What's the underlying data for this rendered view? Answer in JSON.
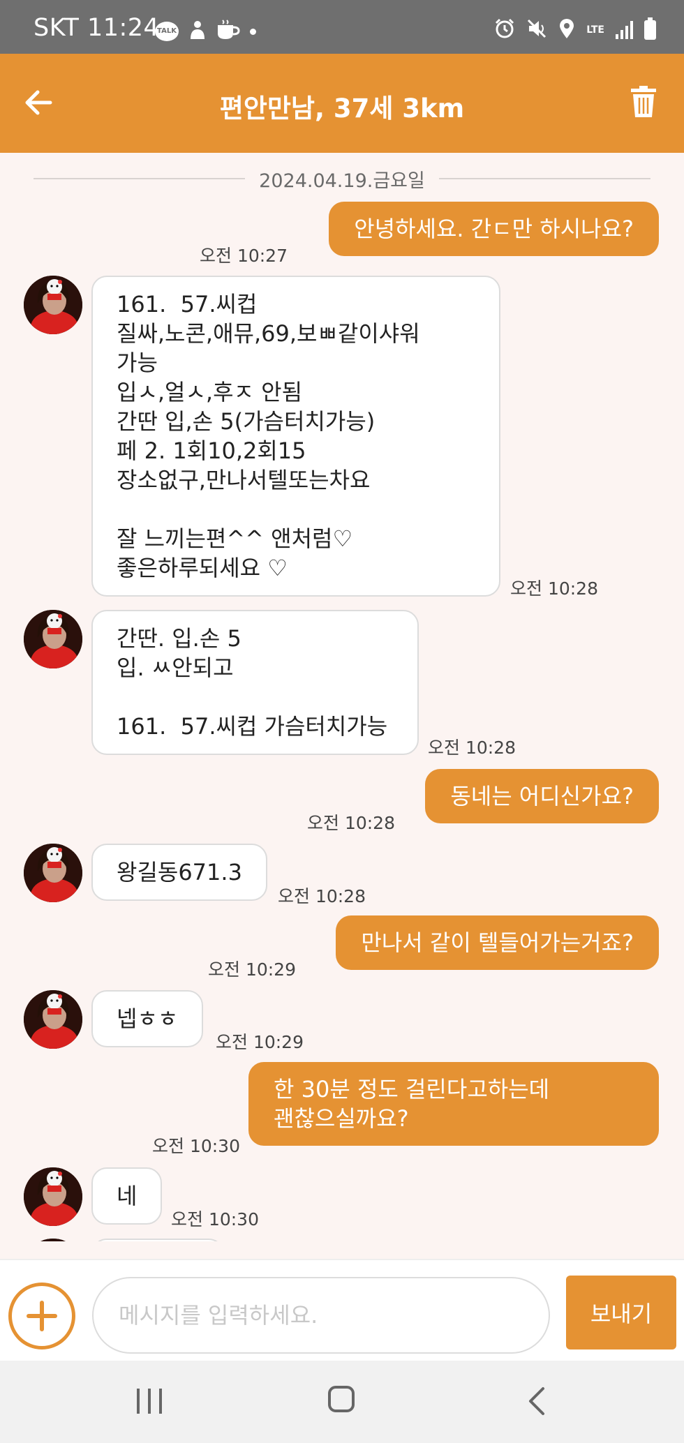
{
  "status_bar": {
    "carrier_time": "SKT 11:24",
    "talk_badge": "TALK",
    "network": "LTE",
    "icons": [
      "kakaotalk-icon",
      "person-icon",
      "coffee-icon",
      "alarm-icon",
      "mute-icon",
      "location-icon",
      "signal-icon",
      "battery-icon"
    ]
  },
  "header": {
    "title": "편안만남, 37세 3km",
    "back_icon": "arrow-left-icon",
    "delete_icon": "trash-icon",
    "color": "#e59233"
  },
  "chat": {
    "date": "2024.04.19.금요일",
    "messages": [
      {
        "dir": "sent",
        "text": "안녕하세요. 간ㄷ만 하시나요?",
        "time": "오전 10:27"
      },
      {
        "dir": "recv",
        "text": "161.  57.씨컵\n질싸,노콘,애뮤,69,보ㅃ같이샤워\n가능\n입ㅅ,얼ㅅ,후ㅈ 안됨\n간딴 입,손 5(가슴터치가능)\n페 2. 1회10,2회15\n장소없구,만나서텔또는차요\n\n잘 느끼는편^^ 앤처럼♡\n좋은하루되세요 ♡",
        "time": "오전 10:28"
      },
      {
        "dir": "recv",
        "text": "간딴. 입.손 5\n입. ㅆ안되고\n\n161.  57.씨컵 가슴터치가능",
        "time": "오전 10:28"
      },
      {
        "dir": "sent",
        "text": "동네는 어디신가요?",
        "time": "오전 10:28"
      },
      {
        "dir": "recv",
        "text": "왕길동671.3",
        "time": "오전 10:28"
      },
      {
        "dir": "sent",
        "text": "만나서 같이 텔들어가는거죠?",
        "time": "오전 10:29"
      },
      {
        "dir": "recv",
        "text": "넵ㅎㅎ",
        "time": "오전 10:29"
      },
      {
        "dir": "sent",
        "text": "한 30분 정도 걸린다고하는데\n괜찮으실까요?",
        "time": "오전 10:30"
      },
      {
        "dir": "recv",
        "text": "네",
        "time": "오전 10:30"
      }
    ]
  },
  "input_bar": {
    "placeholder": "메시지를 입력하세요.",
    "value": "",
    "send_label": "보내기",
    "attach_icon": "plus-circle-icon"
  },
  "nav_bar": {
    "icons": [
      "recent-apps-icon",
      "home-icon",
      "back-icon"
    ]
  }
}
